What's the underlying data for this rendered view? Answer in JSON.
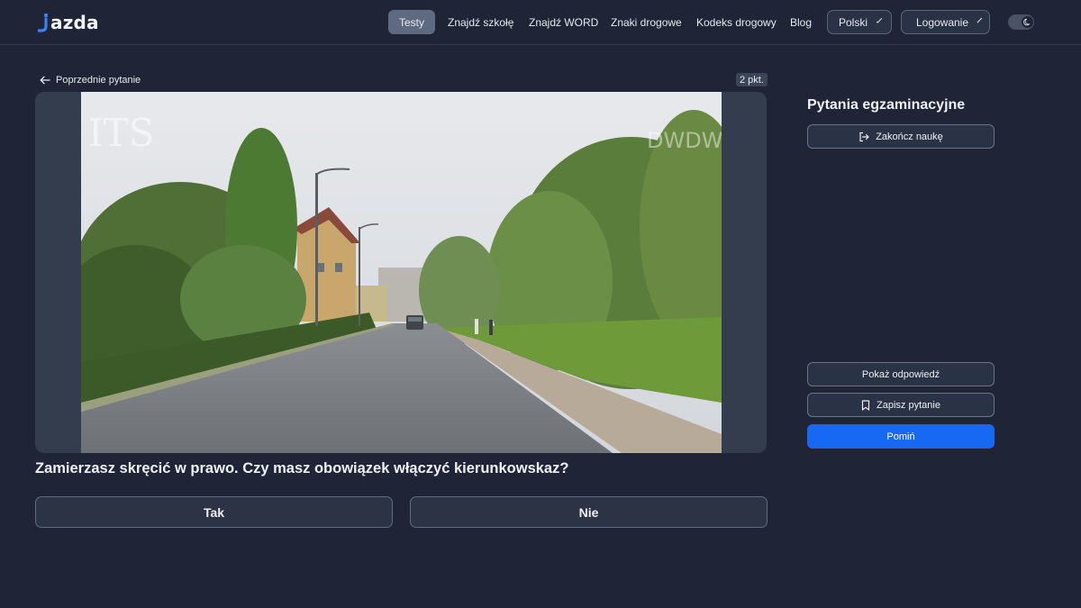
{
  "brand": {
    "logo": "jazda"
  },
  "nav": {
    "items": [
      {
        "label": "Testy",
        "active": true
      },
      {
        "label": "Znajdź szkołę"
      },
      {
        "label": "Znajdź WORD"
      },
      {
        "label": "Znaki drogowe"
      },
      {
        "label": "Kodeks drogowy"
      },
      {
        "label": "Blog"
      }
    ],
    "language": "Polski",
    "login": "Logowanie",
    "theme_toggle": {
      "state": "dark",
      "icon": "moon-icon"
    }
  },
  "question": {
    "previous_label": "Poprzednie pytanie",
    "points": "2 pkt.",
    "text": "Zamierzasz skręcić w prawo. Czy masz obowiązek włączyć kierunkowskaz?",
    "answers": [
      "Tak",
      "Nie"
    ],
    "media": {
      "kind": "photo",
      "description": "road scene",
      "watermarks": [
        "ITS",
        "DWDW"
      ]
    }
  },
  "sidebar": {
    "title": "Pytania egzaminacyjne",
    "end_label": "Zakończ naukę",
    "show_answer_label": "Pokaż odpowiedź",
    "save_label": "Zapisz pytanie",
    "skip_label": "Pomiń"
  },
  "colors": {
    "background": "#1f2536",
    "accent": "#1769f4",
    "logo_accent": "#3b82f6",
    "active_nav": "#5e6a80"
  }
}
